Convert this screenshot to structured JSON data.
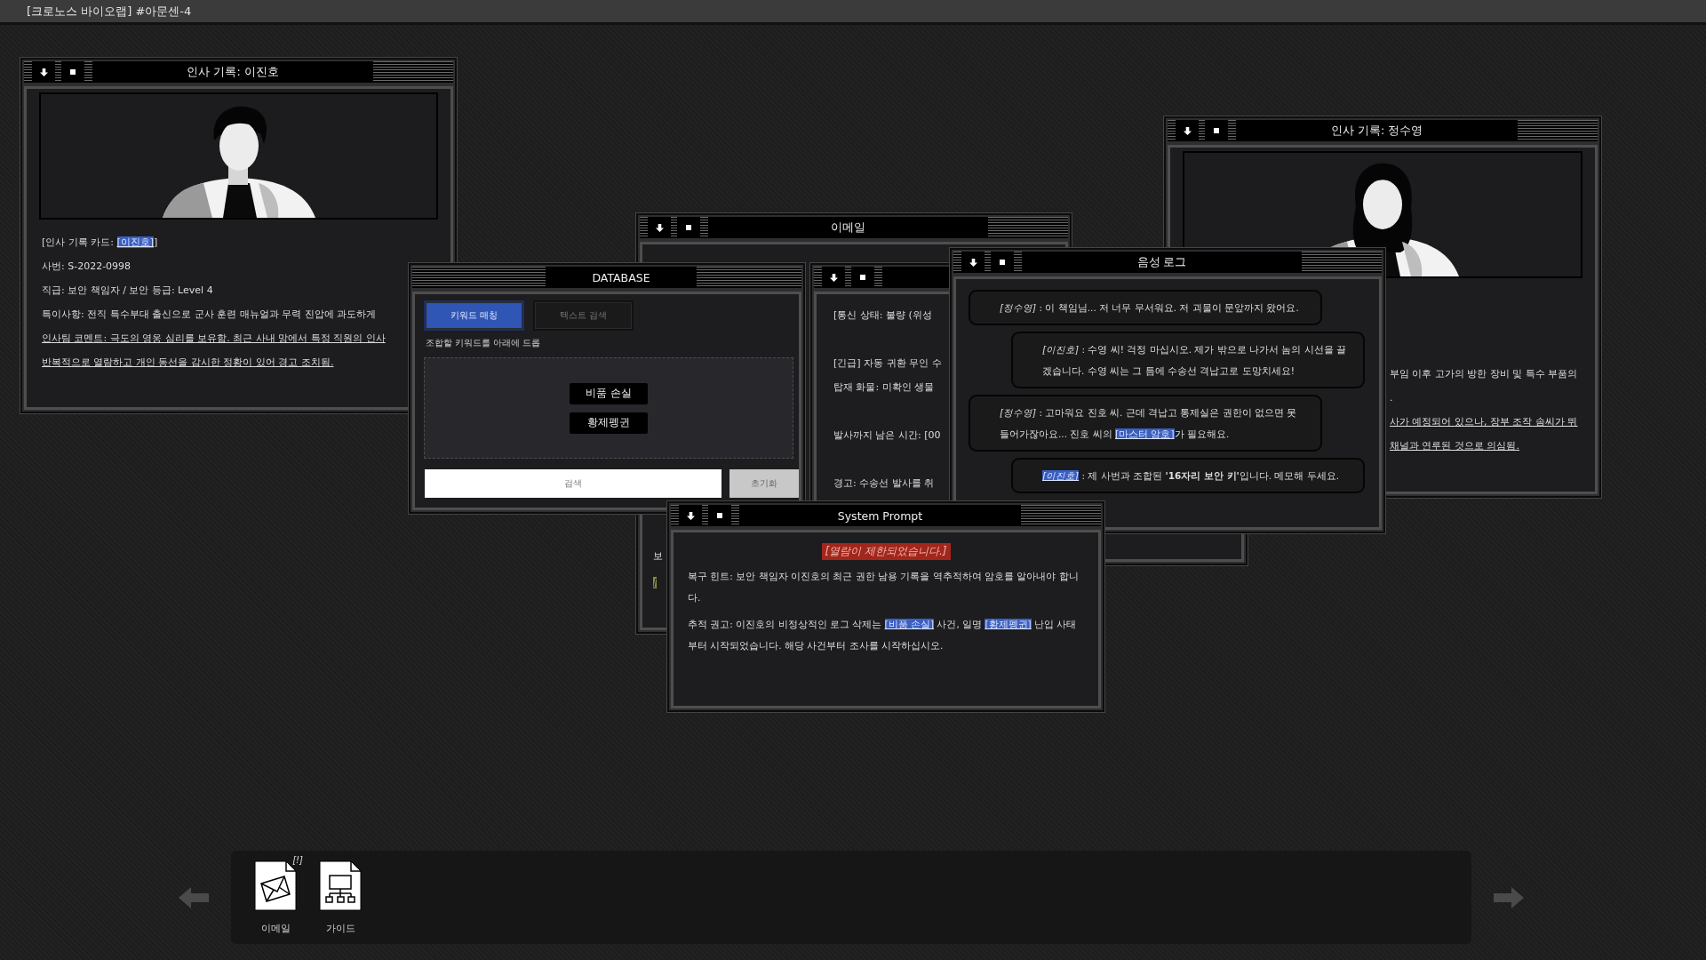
{
  "header": {
    "title": "[크로노스 바이오랩] #아문센-4"
  },
  "windows": [
    {
      "kind": "profile",
      "title": "인사 기록: 이진호",
      "portrait": {
        "kind": "picture"
      },
      "lines": [
        {
          "underline": false,
          "parts": [
            {
              "text": "[인사 기록 카드: ",
              "link": false
            },
            {
              "text": "[이진호]",
              "link": true
            },
            {
              "text": "]",
              "link": false
            }
          ]
        },
        {
          "underline": false,
          "parts": [
            {
              "text": "사번: S-2022-0998",
              "link": false
            }
          ]
        },
        {
          "underline": false,
          "parts": [
            {
              "text": "직급: 보안 책임자 / 보안 등급: Level 4",
              "link": false
            }
          ]
        },
        {
          "underline": false,
          "parts": [
            {
              "text": "특이사항: 전직 특수부대 출신으로 군사 훈련 매뉴얼과 무력 진압에 과도하게",
              "link": false
            }
          ]
        },
        {
          "underline": true,
          "parts": [
            {
              "text": "인사팀 코멘트: 극도의 영웅 심리를 보유함. 최근 사내 망에서 특정 직원의 인사",
              "link": false
            }
          ]
        },
        {
          "underline": true,
          "parts": [
            {
              "text": "반복적으로 열람하고 개인 동선을 감시한 정황이 있어 경고 조치됨.",
              "link": false
            }
          ]
        }
      ]
    },
    {
      "kind": "email",
      "title": "이메일",
      "lines": [
        {
          "text": "보",
          "highlight": false
        },
        {
          "text": "[",
          "highlight": true
        }
      ]
    },
    {
      "kind": "database",
      "title": "DATABASE",
      "tabs": [
        {
          "label": "키워드 매칭",
          "selected": true
        },
        {
          "label": "텍스트 검색",
          "selected": false
        }
      ],
      "hint": "조합할 키워드를 아래에 드롭",
      "chips": [
        "비품 손실",
        "황제펭귄"
      ],
      "buttons": [
        {
          "label": "검색",
          "kind": "primary"
        },
        {
          "label": "초기화",
          "kind": "secondary"
        }
      ]
    },
    {
      "kind": "profile",
      "title": "인사 기록: 정수영",
      "portrait": {
        "kind": "picture"
      },
      "lines": [
        {
          "underline": false,
          "parts": [
            {
              "text": "부임 이후 고가의 방한 장비 및 특수 부품의",
              "link": false
            }
          ]
        },
        {
          "underline": false,
          "parts": [
            {
              "text": ".",
              "link": false
            }
          ]
        },
        {
          "underline": true,
          "parts": [
            {
              "text": "사가 예정되어 있으나, 장부 조작 솜씨가 뛰",
              "link": false
            }
          ]
        },
        {
          "underline": true,
          "parts": [
            {
              "text": "채널과 연루된 것으로 의심됨.",
              "link": false
            }
          ]
        }
      ]
    },
    {
      "kind": "messages",
      "groups": [
        [
          "[통신 상태: 불량 (위성"
        ],
        [
          "[긴급] 자동 귀환 무인 수",
          "탑재 화물: 미확인 생물"
        ],
        [
          "발사까지 남은 시간: [00"
        ],
        [
          "경고: 수송선 발사를 취"
        ]
      ]
    },
    {
      "kind": "voice_log",
      "title": "음성 로그",
      "messages": [
        {
          "outgoing": false,
          "parts": [
            {
              "text": "*[정수영]*",
              "link": false
            },
            {
              "text": " : 이 책임님... 저 너무 무서워요. 저 괴물이 문앞까지 왔어요.",
              "link": false
            }
          ]
        },
        {
          "outgoing": true,
          "parts": [
            {
              "text": "*[이진호]*",
              "link": false
            },
            {
              "text": " : 수영 씨! 걱정 마십시오. 제가 밖으로 나가서 놈의 시선을 끌겠습니다. 수영 씨는 그 틈에 수송선 격납고로 도망치세요!",
              "link": false
            }
          ]
        },
        {
          "outgoing": false,
          "parts": [
            {
              "text": "*[정수영]*",
              "link": false
            },
            {
              "text": " : 고마워요 진호 씨. 근데 격납고 통제실은 권한이 없으면 못 들어가잖아요... 진호 씨의 ",
              "link": false
            },
            {
              "text": "[마스터 암호]",
              "link": true
            },
            {
              "text": "가 필요해요.",
              "link": false
            }
          ]
        },
        {
          "outgoing": true,
          "parts": [
            {
              "text": "*[이진호]*",
              "link": true
            },
            {
              "text": " : 제 사번과 조합된 **'16자리 보안 키'**입니다. 메모해 두세요.",
              "link": false
            }
          ]
        }
      ]
    },
    {
      "kind": "system_prompt",
      "title": "System Prompt",
      "banner": "[열람이 제한되었습니다.]",
      "paragraphs": [
        [
          {
            "text": "복구 힌트: 보안 책임자 이진호의 최근 권한 남용 기록을 역추적하여 암호를 알아내야 합니다.",
            "link": false
          }
        ],
        [
          {
            "text": "추적 권고: 이진호의 비정상적인 로그 삭제는 ",
            "link": false
          },
          {
            "text": "[비품 손실]",
            "link": true
          },
          {
            "text": " 사건, 일명 ",
            "link": false
          },
          {
            "text": "[황제펭귄]",
            "link": true
          },
          {
            "text": " 난입 사태부터 시작되었습니다. 해당 사건부터 조사를 시작하십시오.",
            "link": false
          }
        ]
      ]
    }
  ],
  "dock": {
    "apps": [
      {
        "kind": "email",
        "label": "이메일",
        "badge": "[!]"
      },
      {
        "kind": "guide",
        "label": "가이드"
      }
    ]
  }
}
